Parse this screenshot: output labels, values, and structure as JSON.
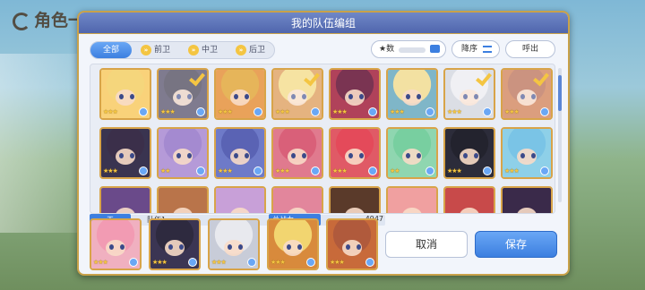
{
  "background": {
    "title": "角色一览"
  },
  "dialog": {
    "title": "我的队伍编组"
  },
  "filters": [
    {
      "label": "全部",
      "active": true
    },
    {
      "label": "前卫",
      "active": false
    },
    {
      "label": "中卫",
      "active": false
    },
    {
      "label": "后卫",
      "active": false
    }
  ],
  "sort": {
    "label": "★数"
  },
  "order_button": {
    "label": "降序"
  },
  "call_button": {
    "label": "呼出"
  },
  "colors": {
    "accent": "#3c7fe0",
    "gold": "#d8a449",
    "check": "#f4c542"
  },
  "roster": [
    {
      "stars": "★★★",
      "selected": false,
      "bg": "#f9d27a",
      "hair": "#f5d67c"
    },
    {
      "stars": "★★★",
      "selected": true,
      "bg": "#3b3553",
      "hair": "#2e2a3f"
    },
    {
      "stars": "★★★",
      "selected": false,
      "bg": "#e9a25a",
      "hair": "#e6b55a"
    },
    {
      "stars": "★★★",
      "selected": true,
      "bg": "#d88a3c",
      "hair": "#f2d570"
    },
    {
      "stars": "★★★",
      "selected": false,
      "bg": "#b0425a",
      "hair": "#7a3452"
    },
    {
      "stars": "★★★",
      "selected": false,
      "bg": "#7fb6c8",
      "hair": "#f3e1a2"
    },
    {
      "stars": "★★★",
      "selected": true,
      "bg": "#c8ccd8",
      "hair": "#e8e9ee"
    },
    {
      "stars": "★★★",
      "selected": true,
      "bg": "#c86a3a",
      "hair": "#b05a3c"
    },
    {
      "stars": "★★★",
      "selected": false,
      "bg": "#3a3450",
      "hair": "#3b2f4a"
    },
    {
      "stars": "★★",
      "selected": false,
      "bg": "#b59ad8",
      "hair": "#a48ad0"
    },
    {
      "stars": "★★★",
      "selected": false,
      "bg": "#6e7ac8",
      "hair": "#5a63b4"
    },
    {
      "stars": "★★★",
      "selected": false,
      "bg": "#e07a8e",
      "hair": "#d96079"
    },
    {
      "stars": "★★★",
      "selected": false,
      "bg": "#e05a66",
      "hair": "#e44a5a"
    },
    {
      "stars": "★★",
      "selected": false,
      "bg": "#8fd6b0",
      "hair": "#78cfa0"
    },
    {
      "stars": "★★★",
      "selected": false,
      "bg": "#2c2c3a",
      "hair": "#23232e"
    },
    {
      "stars": "★★★",
      "selected": false,
      "bg": "#8ed0e8",
      "hair": "#7ac4e6"
    },
    {
      "stars": "",
      "selected": false,
      "bg": "#6a4a8a",
      "hair": "#6a4a8a"
    },
    {
      "stars": "",
      "selected": false,
      "bg": "#b9744a",
      "hair": "#b9744a"
    },
    {
      "stars": "",
      "selected": false,
      "bg": "#c8a0d8",
      "hair": "#c8a0d8"
    },
    {
      "stars": "",
      "selected": false,
      "bg": "#e2869c",
      "hair": "#e2869c"
    },
    {
      "stars": "",
      "selected": false,
      "bg": "#5a3a2a",
      "hair": "#5a3a2a"
    },
    {
      "stars": "",
      "selected": false,
      "bg": "#f0a0a0",
      "hair": "#f0a0a0"
    },
    {
      "stars": "",
      "selected": false,
      "bg": "#c84a4a",
      "hair": "#c84a4a"
    },
    {
      "stars": "",
      "selected": false,
      "bg": "#3a2a4a",
      "hair": "#3a2a4a"
    }
  ],
  "team": {
    "badge": "天",
    "name": "队伍1",
    "power_label": "总战力",
    "power_value": "4947",
    "members": [
      {
        "stars": "★★★",
        "bg": "#f0b0c0",
        "hair": "#f29bb3"
      },
      {
        "stars": "★★★",
        "bg": "#3b3553",
        "hair": "#2e2a3f"
      },
      {
        "stars": "★★★",
        "bg": "#c8ccd8",
        "hair": "#e8e9ee"
      },
      {
        "stars": "★★★",
        "bg": "#d88a3c",
        "hair": "#f2d570"
      },
      {
        "stars": "★★★",
        "bg": "#c86a3a",
        "hair": "#b05a3c"
      }
    ]
  },
  "cancel_button": {
    "label": "取消"
  },
  "save_button": {
    "label": "保存"
  }
}
